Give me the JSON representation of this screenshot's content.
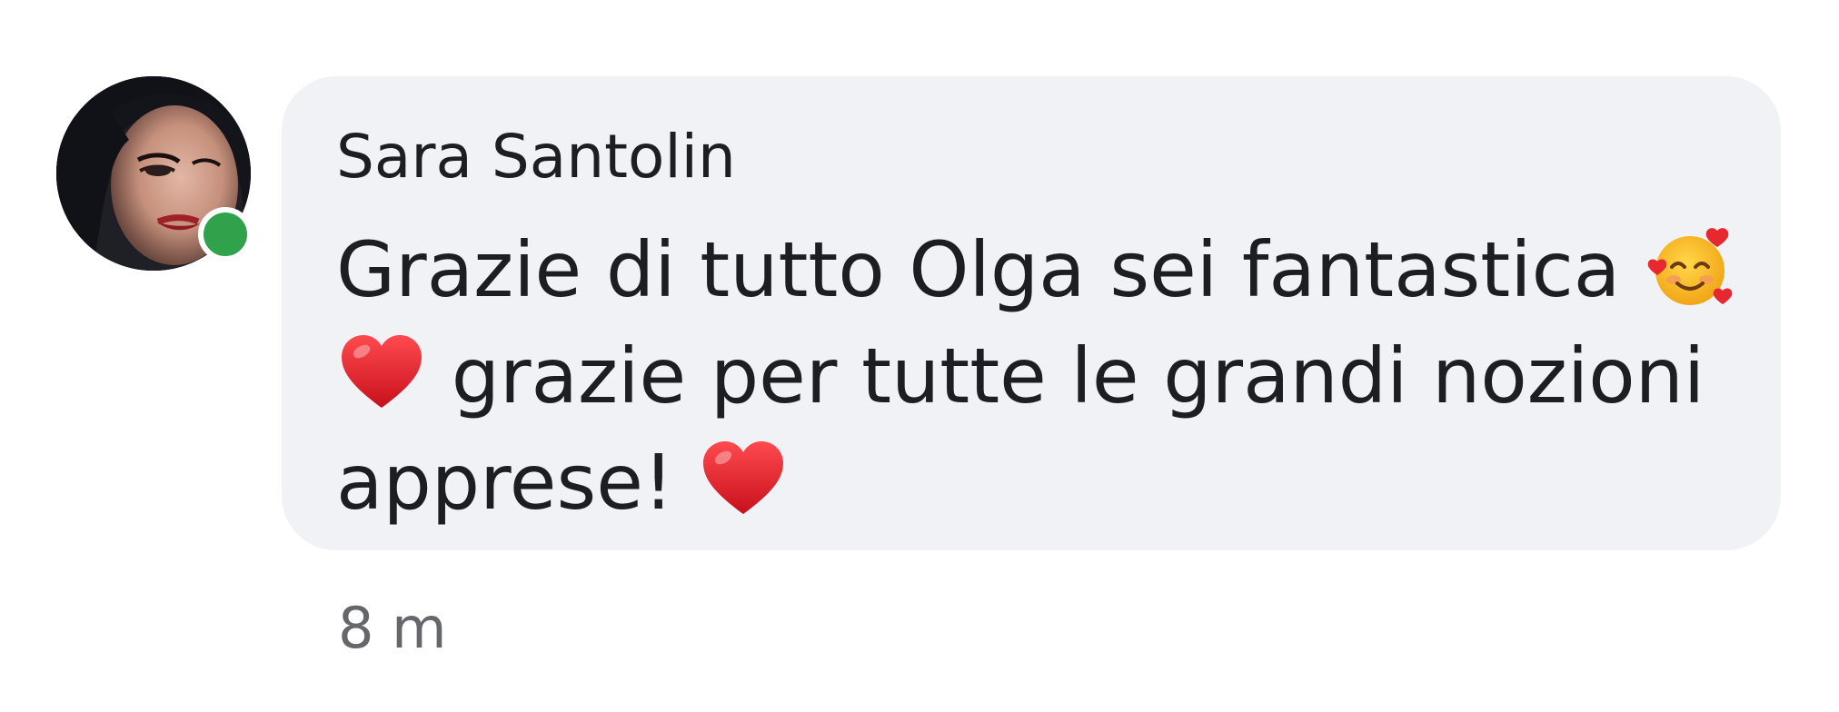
{
  "comment": {
    "author": "Sara Santolin",
    "online": true,
    "body": {
      "line1_text": "Grazie di tutto Olga sei fantastica",
      "line1_emoji": "smiling-face-with-hearts",
      "line2_emoji": "red-heart",
      "line2_text": "grazie per tutte le grandi nozioni",
      "line3_text": "apprese!",
      "line3_emoji": "red-heart"
    },
    "timestamp": "8 m"
  },
  "colors": {
    "bubble_background": "#f0f2f5",
    "text_primary": "#1c1e21",
    "text_secondary": "#65676b",
    "presence_green": "#31a24c"
  },
  "icons": [
    "avatar-photo",
    "presence-dot",
    "smiling-face-with-hearts-icon",
    "red-heart-icon"
  ]
}
